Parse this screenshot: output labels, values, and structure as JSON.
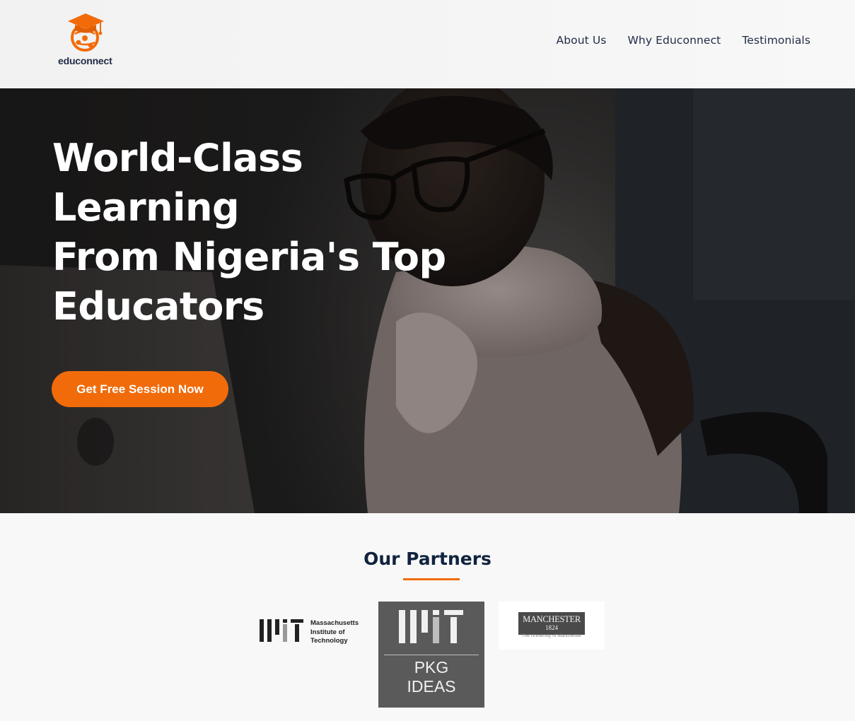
{
  "brand": {
    "name": "educonnect",
    "accent_color": "#f26b0a",
    "navy_color": "#1f2a44",
    "logo_icon": "graduation-cap-globe-icon"
  },
  "nav": {
    "items": [
      {
        "label": "About Us"
      },
      {
        "label": "Why Educonnect"
      },
      {
        "label": "Testimonials"
      }
    ]
  },
  "hero": {
    "title_lines": [
      "World-Class",
      "Learning",
      "From Nigeria's Top",
      "Educators"
    ],
    "cta_label": "Get Free Session Now",
    "image": "student-with-glasses-at-laptop-photo"
  },
  "partners": {
    "heading": "Our Partners",
    "items": [
      {
        "name": "mit",
        "wordmark_lines": [
          "Massachusetts",
          "Institute of",
          "Technology"
        ]
      },
      {
        "name": "mit-pkg",
        "lines": [
          "PKG",
          "IDEAS"
        ]
      },
      {
        "name": "manchester",
        "title": "MANCHESTER",
        "year": "1824",
        "subtitle": "The University of Manchester"
      }
    ]
  }
}
